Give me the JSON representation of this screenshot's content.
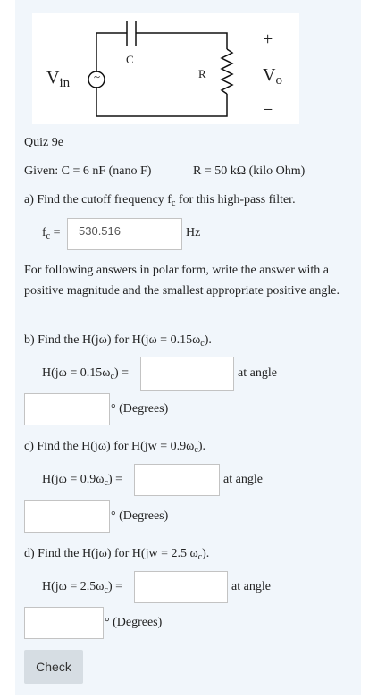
{
  "circuit": {
    "capacitor_label": "C",
    "resistor_label": "R",
    "vin_label": "V",
    "vin_sub": "in",
    "vout_label": "V",
    "vout_sub": "o",
    "plus": "+",
    "minus": "−",
    "source_symbol": "~"
  },
  "quiz": {
    "title": "Quiz 9e",
    "given_c": "Given: C = 6 nF (nano F)",
    "given_r": "R = 50 kΩ (kilo Ohm)",
    "qa": {
      "prefix": "a)  Find the cutoff frequency f",
      "sub": "c",
      "suffix": " for this high-pass filter.",
      "field_prefix": "f",
      "field_sub": "c",
      "field_eq": " =",
      "value": "530.516",
      "unit": "Hz"
    },
    "instructions": "For following answers in polar form, write the answer with a positive magnitude and the smallest appropriate positive angle.",
    "qb": {
      "prefix": "b)  Find the H(jω) for H(jω = 0.15ω",
      "sub": "c",
      "suffix": ").",
      "field_prefix": "H(jω = 0.15ω",
      "field_sub": "c",
      "field_suffix": ") =",
      "at_angle": "at angle",
      "degrees": "° (Degrees)"
    },
    "qc": {
      "prefix": "c)  Find the H(jω) for H(jw = 0.9ω",
      "sub": "c",
      "suffix": ").",
      "field_prefix": "H(jω = 0.9ω",
      "field_sub": "c",
      "field_suffix": ") =",
      "at_angle": "at angle",
      "degrees": "° (Degrees)"
    },
    "qd": {
      "prefix": "d)  Find the H(jω) for H(jw = 2.5 ω",
      "sub": "c",
      "suffix": ").",
      "field_prefix": "H(jω = 2.5ω",
      "field_sub": "c",
      "field_suffix": ") =",
      "at_angle": "at angle",
      "degrees": "° (Degrees)"
    },
    "check_label": "Check"
  }
}
